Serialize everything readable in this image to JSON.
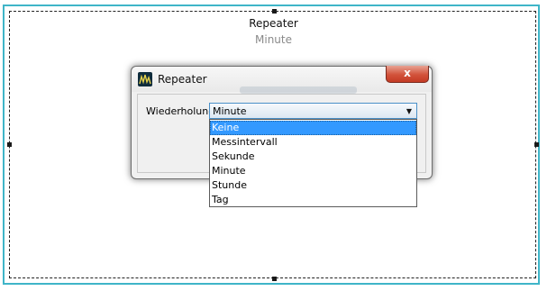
{
  "component": {
    "title": "Repeater",
    "value": "Minute"
  },
  "dialog": {
    "title": "Repeater",
    "close_label": "x",
    "field_label": "Wiederholung",
    "select_value": "Minute",
    "dropdown_options": [
      "Keine",
      "Messintervall",
      "Sekunde",
      "Minute",
      "Stunde",
      "Tag"
    ],
    "highlighted_option": "Keine"
  },
  "colors": {
    "selection_frame": "#3fb5c8",
    "highlight": "#3399ff",
    "close_button": "#c43a24"
  }
}
